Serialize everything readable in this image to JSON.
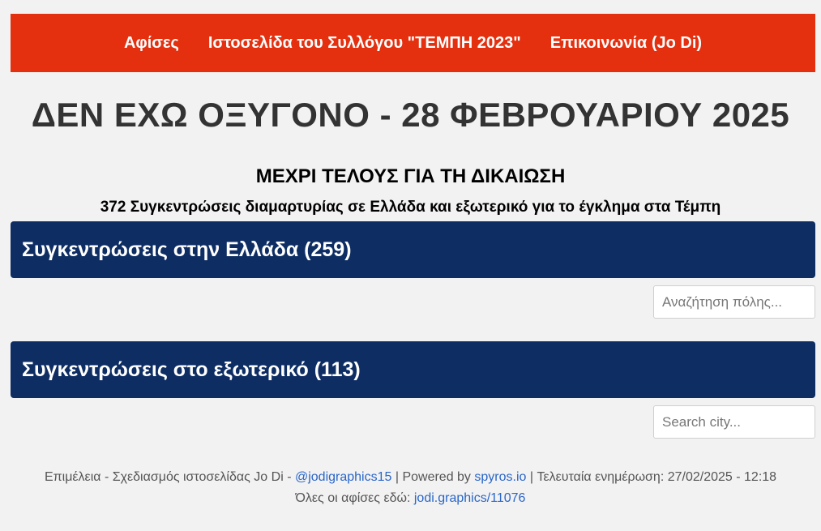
{
  "nav": {
    "items": [
      {
        "label": "Αφίσες"
      },
      {
        "label": "Ιστοσελίδα του Συλλόγου \"ΤΕΜΠΗ 2023\""
      },
      {
        "label": "Επικοινωνία (Jo Di)"
      }
    ],
    "background": "#e4300f"
  },
  "header": {
    "title": "ΔΕΝ ΕΧΩ ΟΞΥΓΟΝΟ - 28 ΦΕΒΡΟΥΑΡΙΟΥ 2025",
    "subtitle": "ΜΕΧΡΙ ΤΕΛΟΥΣ ΓΙΑ ΤΗ ΔΙΚΑΙΩΣΗ",
    "lead": "372 Συγκεντρώσεις διαμαρτυρίας σε Ελλάδα και εξωτερικό για το έγκλημα στα Τέμπη"
  },
  "sections": {
    "greece": {
      "title": "Συγκεντρώσεις στην Ελλάδα (259)",
      "search_placeholder": "Αναζήτηση πόλης..."
    },
    "abroad": {
      "title": "Συγκεντρώσεις στο εξωτερικό (113)",
      "search_placeholder": "Search city..."
    },
    "bar_color": "#0d2d63"
  },
  "footer": {
    "credit_prefix": "Επιμέλεια - Σχεδιασμός ιστοσελίδας Jo Di - ",
    "credit_link": "@jodigraphics15",
    "powered_prefix": " | Powered by ",
    "powered_link": "spyros.io",
    "updated": " | Τελευταία ενημέρωση: 27/02/2025 - 12:18",
    "posters_prefix": "Όλες οι αφίσες εδώ: ",
    "posters_link": "jodi.graphics/11076",
    "link_color": "#2a66c8"
  }
}
